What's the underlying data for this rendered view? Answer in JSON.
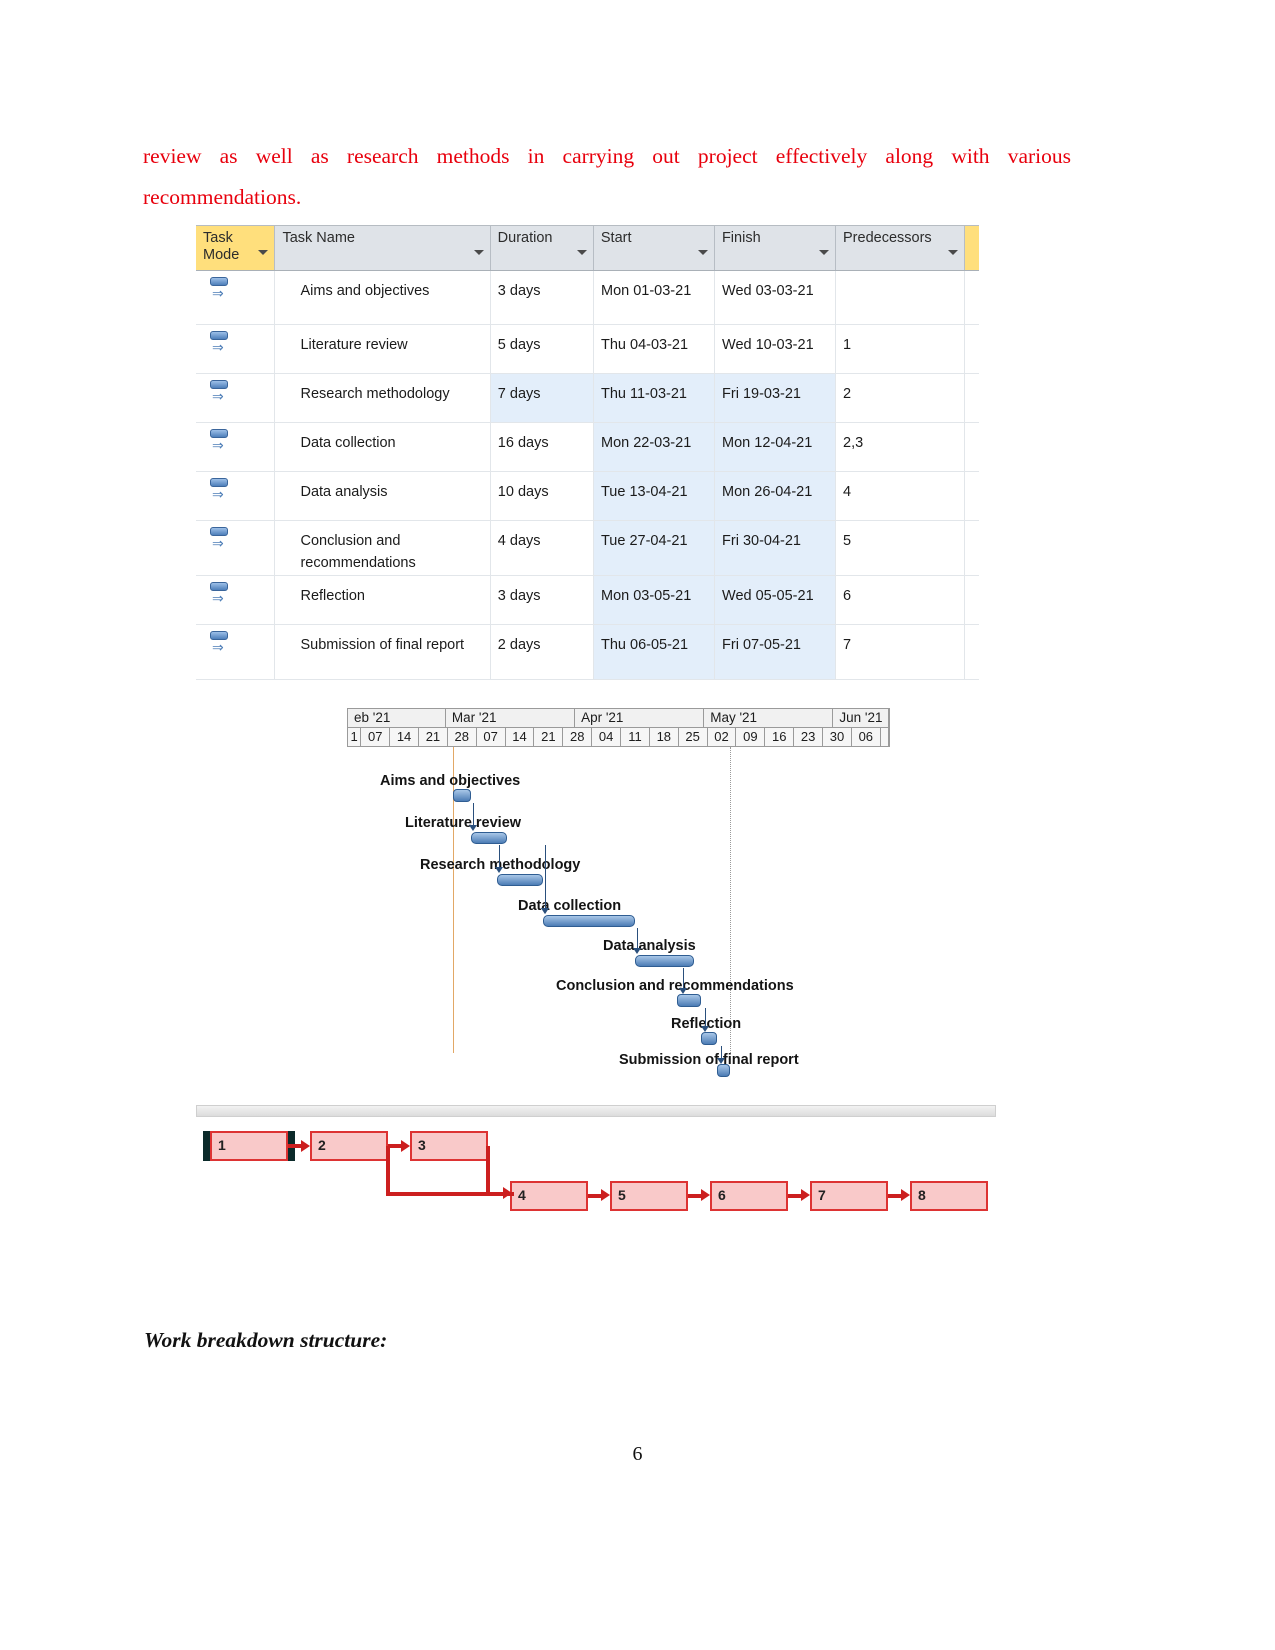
{
  "paragraph": {
    "line1": "review  as  well  as  research  methods  in  carrying  out  project  effectively  along  with  various",
    "line2": "recommendations."
  },
  "task_table": {
    "columns": [
      {
        "key": "task_mode",
        "label": "Task Mode"
      },
      {
        "key": "task_name",
        "label": "Task Name"
      },
      {
        "key": "duration",
        "label": "Duration"
      },
      {
        "key": "start",
        "label": "Start"
      },
      {
        "key": "finish",
        "label": "Finish"
      },
      {
        "key": "predecessors",
        "label": "Predecessors"
      }
    ],
    "rows": [
      {
        "mode_icon": "auto-schedule-icon",
        "name": "Aims and objectives",
        "duration": "3 days",
        "start": "Mon 01-03-21",
        "finish": "Wed 03-03-21",
        "predecessors": ""
      },
      {
        "mode_icon": "auto-schedule-icon",
        "name": "Literature review",
        "duration": "5 days",
        "start": "Thu 04-03-21",
        "finish": "Wed 10-03-21",
        "predecessors": "1"
      },
      {
        "mode_icon": "auto-schedule-icon",
        "name": "Research methodology",
        "duration": "7 days",
        "start": "Thu 11-03-21",
        "finish": "Fri 19-03-21",
        "predecessors": "2"
      },
      {
        "mode_icon": "auto-schedule-icon",
        "name": "Data collection",
        "duration": "16 days",
        "start": "Mon 22-03-21",
        "finish": "Mon 12-04-21",
        "predecessors": "2,3"
      },
      {
        "mode_icon": "auto-schedule-icon",
        "name": "Data analysis",
        "duration": "10 days",
        "start": "Tue 13-04-21",
        "finish": "Mon 26-04-21",
        "predecessors": "4"
      },
      {
        "mode_icon": "auto-schedule-icon",
        "name": "Conclusion and recommendations",
        "duration": "4 days",
        "start": "Tue 27-04-21",
        "finish": "Fri 30-04-21",
        "predecessors": "5"
      },
      {
        "mode_icon": "auto-schedule-icon",
        "name": "Reflection",
        "duration": "3 days",
        "start": "Mon 03-05-21",
        "finish": "Wed 05-05-21",
        "predecessors": "6"
      },
      {
        "mode_icon": "auto-schedule-icon",
        "name": "Submission of final report",
        "duration": "2 days",
        "start": "Thu 06-05-21",
        "finish": "Fri 07-05-21",
        "predecessors": "7"
      }
    ]
  },
  "gantt": {
    "timescale_months": [
      "eb '21",
      "Mar '21",
      "Apr '21",
      "May '21",
      "Jun '21"
    ],
    "timescale_weeks": [
      "1",
      "07",
      "14",
      "21",
      "28",
      "07",
      "14",
      "21",
      "28",
      "04",
      "11",
      "18",
      "25",
      "02",
      "09",
      "16",
      "23",
      "30",
      "06",
      ""
    ],
    "bars": [
      {
        "label": "Aims and objectives",
        "type": "bar"
      },
      {
        "label": "Literature review",
        "type": "bar"
      },
      {
        "label": "Research methodology",
        "type": "bar"
      },
      {
        "label": "Data collection",
        "type": "bar"
      },
      {
        "label": "Data analysis",
        "type": "bar"
      },
      {
        "label": "Conclusion and recommendations",
        "type": "bar"
      },
      {
        "label": "Reflection",
        "type": "bar"
      },
      {
        "label": "Submission of final report",
        "type": "bar"
      }
    ]
  },
  "network": {
    "nodes": [
      "1",
      "2",
      "3",
      "4",
      "5",
      "6",
      "7",
      "8"
    ]
  },
  "wbs_heading": "Work breakdown structure:",
  "footer": {
    "page_number": "6"
  },
  "colors": {
    "paragraph_red": "#e8000d",
    "task_mode_header": "#ffdf7c",
    "header_grey": "#dfe3e8",
    "selection_blue": "#e3eefa",
    "gantt_bar": "#4c7cb5",
    "network_node_fill": "#f9c9c9",
    "network_line": "#cc1f1f"
  }
}
